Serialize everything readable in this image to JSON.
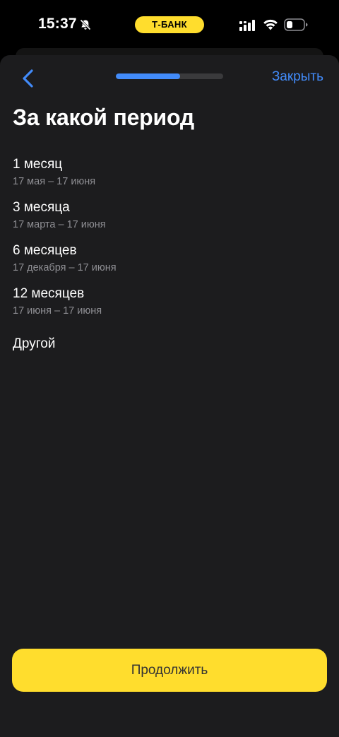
{
  "status_bar": {
    "time": "15:37",
    "brand": "Т-БАНК",
    "brand_color": "#ffdd2d",
    "icons": [
      "bell-slash-icon",
      "signal-icon",
      "wifi-icon",
      "battery-icon"
    ]
  },
  "header": {
    "back_icon": "chevron-left-icon",
    "progress": 0.6,
    "progress_color": "#428bf9",
    "close_label": "Закрыть"
  },
  "page": {
    "title": "За какой период"
  },
  "options": [
    {
      "title": "1 месяц",
      "subtitle": "17 мая – 17 июня"
    },
    {
      "title": "3 месяца",
      "subtitle": "17 марта – 17 июня"
    },
    {
      "title": "6 месяцев",
      "subtitle": "17 декабря – 17 июня"
    },
    {
      "title": "12 месяцев",
      "subtitle": "17 июня – 17 июня"
    }
  ],
  "other_option": "Другой",
  "footer": {
    "continue_label": "Продолжить",
    "button_color": "#ffdd2d"
  }
}
